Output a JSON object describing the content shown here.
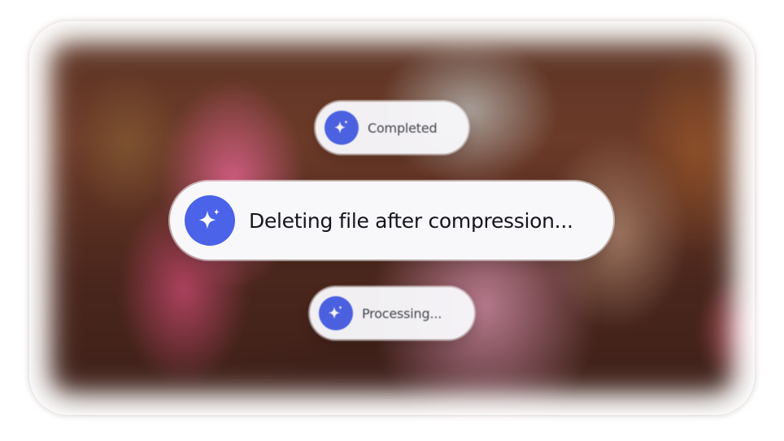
{
  "status_pills": {
    "previous": {
      "label": "Completed",
      "icon": "sparkle-icon"
    },
    "current": {
      "label": "Deleting file after compression...",
      "icon": "sparkle-icon"
    },
    "next": {
      "label": "Processing...",
      "icon": "sparkle-icon"
    }
  },
  "colors": {
    "accent": "#4b63e8",
    "pill_background": "#f8f8fb",
    "primary_text": "#15151c",
    "secondary_text": "#44464f"
  }
}
